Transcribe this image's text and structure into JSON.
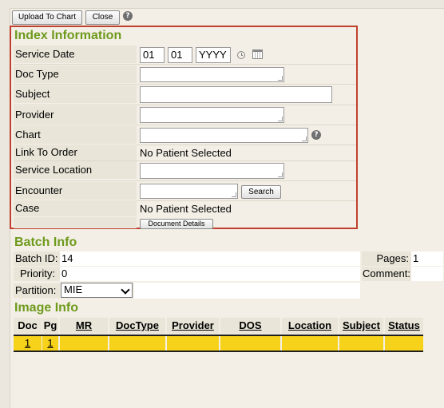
{
  "toolbar": {
    "upload_label": "Upload To Chart",
    "close_label": "Close",
    "help_glyph": "?"
  },
  "index": {
    "title": "Index Information",
    "service_date": {
      "label": "Service Date",
      "month": "01",
      "day": "01",
      "year": "YYYY"
    },
    "doc_type": {
      "label": "Doc Type",
      "value": ""
    },
    "subject": {
      "label": "Subject",
      "value": ""
    },
    "provider": {
      "label": "Provider",
      "value": ""
    },
    "chart": {
      "label": "Chart",
      "value": ""
    },
    "link_to_order": {
      "label": "Link To Order",
      "value": "No Patient Selected"
    },
    "service_location": {
      "label": "Service Location",
      "value": ""
    },
    "encounter": {
      "label": "Encounter",
      "value": "",
      "search_label": "Search"
    },
    "case": {
      "label": "Case",
      "value": "No Patient Selected"
    },
    "document_details_label": "Document Details"
  },
  "batch": {
    "title": "Batch Info",
    "batch_id_label": "Batch ID:",
    "batch_id": "14",
    "pages_label": "Pages:",
    "pages": "1",
    "priority_label": "Priority:",
    "priority": "0",
    "comment_label": "Comment:",
    "comment": "",
    "partition_label": "Partition:",
    "partition": "MIE"
  },
  "image": {
    "title": "Image Info",
    "columns": [
      "Doc",
      "Pg",
      "MR",
      "DocType",
      "Provider",
      "DOS",
      "Location",
      "Subject",
      "Status"
    ],
    "rows": [
      [
        "1",
        "1",
        "",
        "",
        "",
        "",
        "",
        "",
        ""
      ]
    ]
  },
  "colors": {
    "accent_title": "#6e9a1c",
    "highlight_border": "#c0402f",
    "row_highlight": "#f7d21a"
  }
}
